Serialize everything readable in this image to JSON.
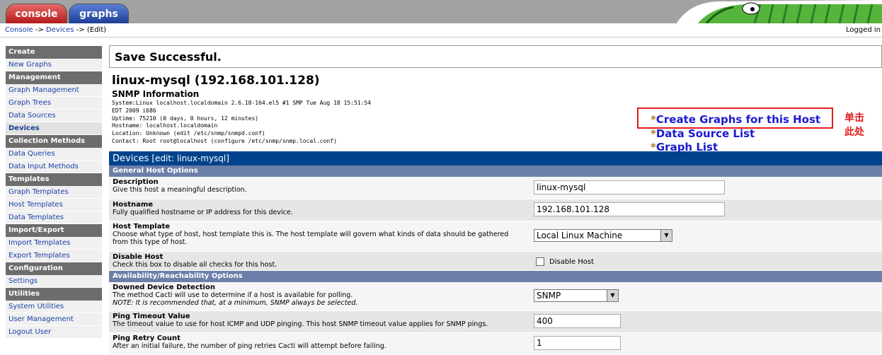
{
  "tabs": {
    "console": "console",
    "graphs": "graphs"
  },
  "breadcrumb": {
    "console": "Console",
    "sep1": " -> ",
    "devices": "Devices",
    "sep2": " -> ",
    "current": "(Edit)"
  },
  "logged_in": "Logged in",
  "sidebar": [
    {
      "label": "Create",
      "type": "head"
    },
    {
      "label": "New Graphs",
      "type": "item"
    },
    {
      "label": "Management",
      "type": "head"
    },
    {
      "label": "Graph Management",
      "type": "item"
    },
    {
      "label": "Graph Trees",
      "type": "item"
    },
    {
      "label": "Data Sources",
      "type": "item"
    },
    {
      "label": "Devices",
      "type": "active"
    },
    {
      "label": "Collection Methods",
      "type": "head"
    },
    {
      "label": "Data Queries",
      "type": "item"
    },
    {
      "label": "Data Input Methods",
      "type": "item"
    },
    {
      "label": "Templates",
      "type": "head"
    },
    {
      "label": "Graph Templates",
      "type": "item"
    },
    {
      "label": "Host Templates",
      "type": "item"
    },
    {
      "label": "Data Templates",
      "type": "item"
    },
    {
      "label": "Import/Export",
      "type": "head"
    },
    {
      "label": "Import Templates",
      "type": "item"
    },
    {
      "label": "Export Templates",
      "type": "item"
    },
    {
      "label": "Configuration",
      "type": "head"
    },
    {
      "label": "Settings",
      "type": "item"
    },
    {
      "label": "Utilities",
      "type": "head"
    },
    {
      "label": "System Utilities",
      "type": "item"
    },
    {
      "label": "User Management",
      "type": "item"
    },
    {
      "label": "Logout User",
      "type": "item"
    }
  ],
  "main": {
    "save_message": "Save Successful.",
    "host_title": "linux-mysql (192.168.101.128)",
    "snmp_title": "SNMP Information",
    "snmp_lines": [
      "System:Linux localhost.localdomain 2.6.18-164.el5 #1 SMP Tue Aug 18 15:51:54",
      "EDT 2009 i686",
      "Uptime: 75210 (0 days, 0 hours, 12 minutes)",
      "Hostname: localhost.localdomain",
      "Location: Unknown (edit /etc/snmp/snmpd.conf)",
      "Contact: Root root@localhost (configure /etc/snmp/snmp.local.conf)"
    ],
    "links": [
      {
        "star": "*",
        "label": "Create Graphs for this Host"
      },
      {
        "star": "*",
        "label": "Data Source List"
      },
      {
        "star": "*",
        "label": "Graph List"
      }
    ],
    "annotation": "单击此处",
    "form_header": {
      "title": "Devices",
      "edit": "[edit: linux-mysql]"
    },
    "section_general": "General Host Options",
    "section_availability": "Availability/Reachability Options",
    "fields": {
      "description": {
        "label": "Description",
        "desc": "Give this host a meaningful description.",
        "value": "linux-mysql"
      },
      "hostname": {
        "label": "Hostname",
        "desc": "Fully qualified hostname or IP address for this device.",
        "value": "192.168.101.128"
      },
      "host_template": {
        "label": "Host Template",
        "desc": "Choose what type of host, host template this is. The host template will govern what kinds of data should be gathered from this type of host.",
        "value": "Local Linux Machine"
      },
      "disable_host": {
        "label": "Disable Host",
        "desc": "Check this box to disable all checks for this host.",
        "checkbox_label": "Disable Host"
      },
      "downed": {
        "label": "Downed Device Detection",
        "desc": "The method Cacti will use to determine if a host is available for polling.",
        "note": "NOTE: It is recommended that, at a minimum, SNMP always be selected.",
        "value": "SNMP"
      },
      "ping_timeout": {
        "label": "Ping Timeout Value",
        "desc": "The timeout value to use for host ICMP and UDP pinging. This host SNMP timeout value applies for SNMP pings.",
        "value": "400"
      },
      "ping_retry": {
        "label": "Ping Retry Count",
        "desc": "After an initial failure, the number of ping retries Cacti will attempt before failing.",
        "value": "1"
      }
    }
  },
  "colors": {
    "accent": "#00438c",
    "section": "#6b7fa9",
    "highlight": "#e01c1c",
    "link": "#1a1ad0"
  }
}
